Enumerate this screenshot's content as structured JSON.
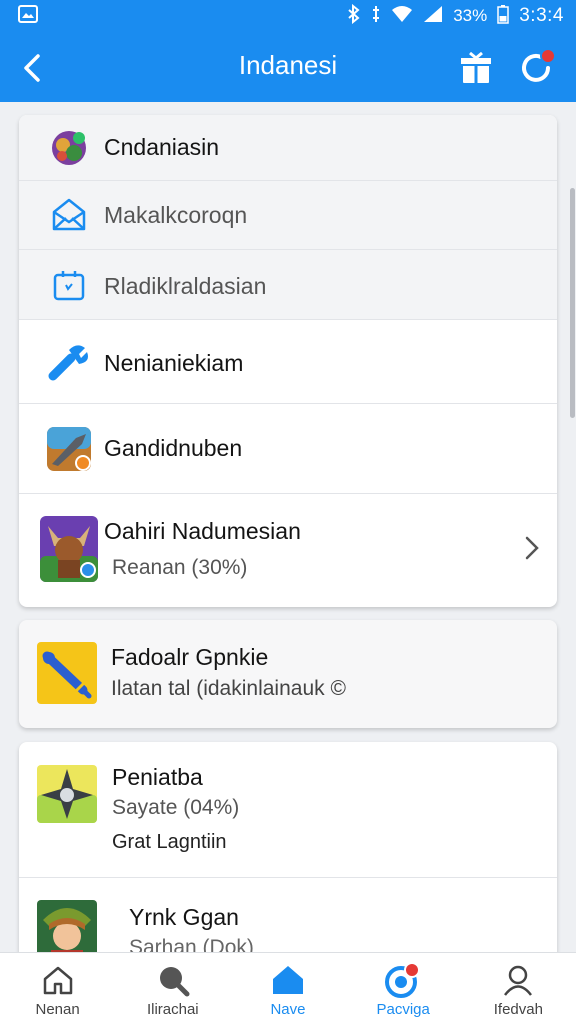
{
  "status_bar": {
    "battery": "33%",
    "time": "3:3:4"
  },
  "header": {
    "title": "Indanesi"
  },
  "menu_card": {
    "items": [
      {
        "label": "Cndaniasin",
        "icon": "game-avatar-icon"
      },
      {
        "label": "Makalkcoroqn",
        "icon": "envelope-icon"
      },
      {
        "label": "Rladiklraldasian",
        "icon": "calendar-icon"
      },
      {
        "label": "Nenianiekiam",
        "icon": "wrench-icon"
      },
      {
        "label": "Gandidnuben",
        "icon": "weapon-game-icon"
      },
      {
        "label": "Oahiri Nadumesian",
        "sub": "Reanan (30%)",
        "icon": "minotaur-game-icon"
      }
    ]
  },
  "promo_card": {
    "title": "Fadoalr Gpnkie",
    "sub": "Ilatan tal (idakinlainauk ©",
    "icon": "yellow-tool-icon"
  },
  "list_card": {
    "items": [
      {
        "title": "Peniatba",
        "sub": "Sayate (04%)",
        "extra": "Grat Lagntiin",
        "icon": "shuriken-game-icon"
      },
      {
        "title": "Yrnk Ggan",
        "sub": "Sarhan (Dok)",
        "icon": "warrior-game-icon"
      }
    ]
  },
  "bottom_nav": {
    "items": [
      {
        "label": "Nenan",
        "icon": "home-outline-icon"
      },
      {
        "label": "Ilirachai",
        "icon": "search-icon"
      },
      {
        "label": "Nave",
        "icon": "home-filled-icon"
      },
      {
        "label": "Pacviga",
        "icon": "target-icon"
      },
      {
        "label": "Ifedvah",
        "icon": "profile-icon"
      }
    ],
    "active_index": 2
  },
  "colors": {
    "primary": "#1a8cf0",
    "badge": "#e53935"
  }
}
